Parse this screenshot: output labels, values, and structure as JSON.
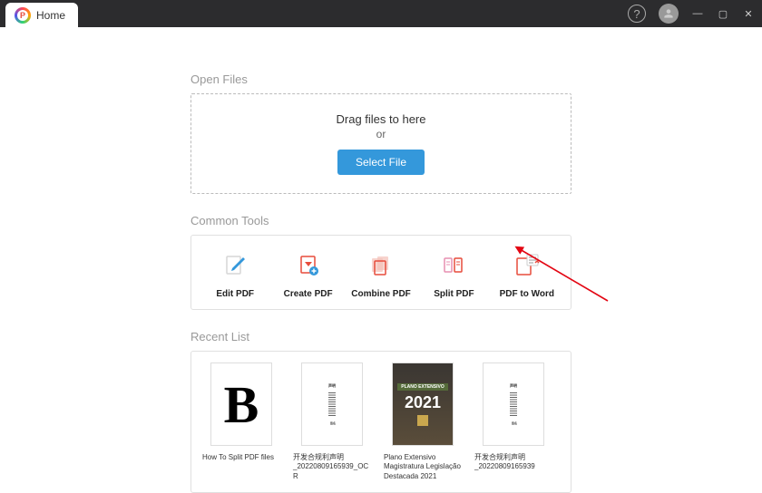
{
  "titlebar": {
    "tab_label": "Home"
  },
  "open_files": {
    "title": "Open Files",
    "drag_text": "Drag files to here",
    "or_text": "or",
    "button_label": "Select File"
  },
  "common_tools": {
    "title": "Common Tools",
    "items": [
      {
        "label": "Edit PDF"
      },
      {
        "label": "Create PDF"
      },
      {
        "label": "Combine PDF"
      },
      {
        "label": "Split PDF"
      },
      {
        "label": "PDF to Word"
      }
    ]
  },
  "recent": {
    "title": "Recent List",
    "items": [
      {
        "label": "How To Split PDF files"
      },
      {
        "label": "开发合规利声明_20220809165939_OCR"
      },
      {
        "label": "Plano Extensivo Magistratura Legislação Destacada 2021"
      },
      {
        "label": "开发合规利声明_20220809165939"
      }
    ]
  }
}
